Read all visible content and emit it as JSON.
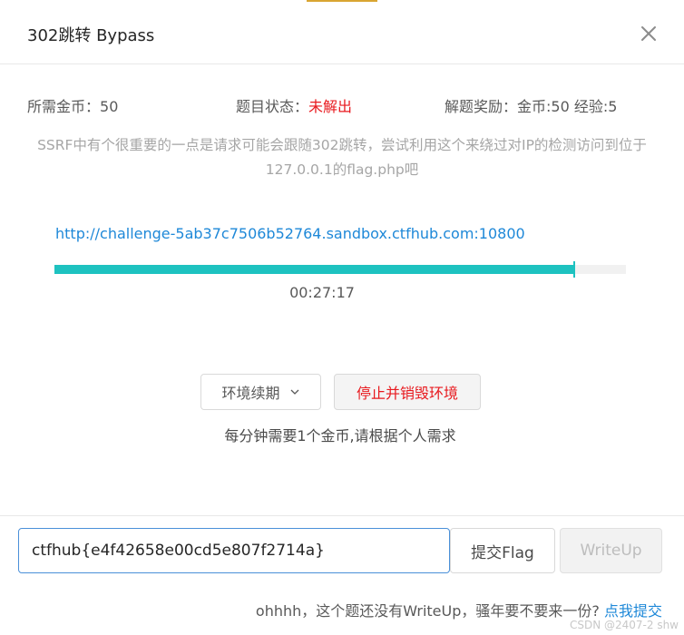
{
  "dialog": {
    "title": "302跳转 Bypass"
  },
  "info": {
    "coins_label": "所需金币：",
    "coins_value": "50",
    "status_label": "题目状态：",
    "status_value": "未解出",
    "reward_label": "解题奖励：",
    "reward_value": "金币:50 经验:5"
  },
  "description": "SSRF中有个很重要的一点是请求可能会跟随302跳转，尝试利用这个来绕过对IP的检测访问到位于127.0.0.1的flag.php吧",
  "challenge": {
    "url": "http://challenge-5ab37c7506b52764.sandbox.ctfhub.com:10800",
    "progress": 0.91,
    "timer": "00:27:17"
  },
  "actions": {
    "renew_label": "环境续期",
    "stop_label": "停止并销毁环境",
    "cost_note": "每分钟需要1个金币,请根据个人需求"
  },
  "footer": {
    "flag_value": "ctfhub{e4f42658e00cd5e807f2714a}",
    "submit_label": "提交Flag",
    "writeup_label": "WriteUp",
    "writeup_note": "ohhhh，这个题还没有WriteUp，骚年要不要来一份?",
    "writeup_link": "点我提交"
  },
  "watermark": "CSDN @2407-2 shw",
  "colors": {
    "accent": "#1ec2c0",
    "link": "#1e88d8",
    "danger": "#e8191e"
  },
  "icons": {
    "close": "close-icon",
    "renew_dropdown": "chevron-down-icon"
  }
}
